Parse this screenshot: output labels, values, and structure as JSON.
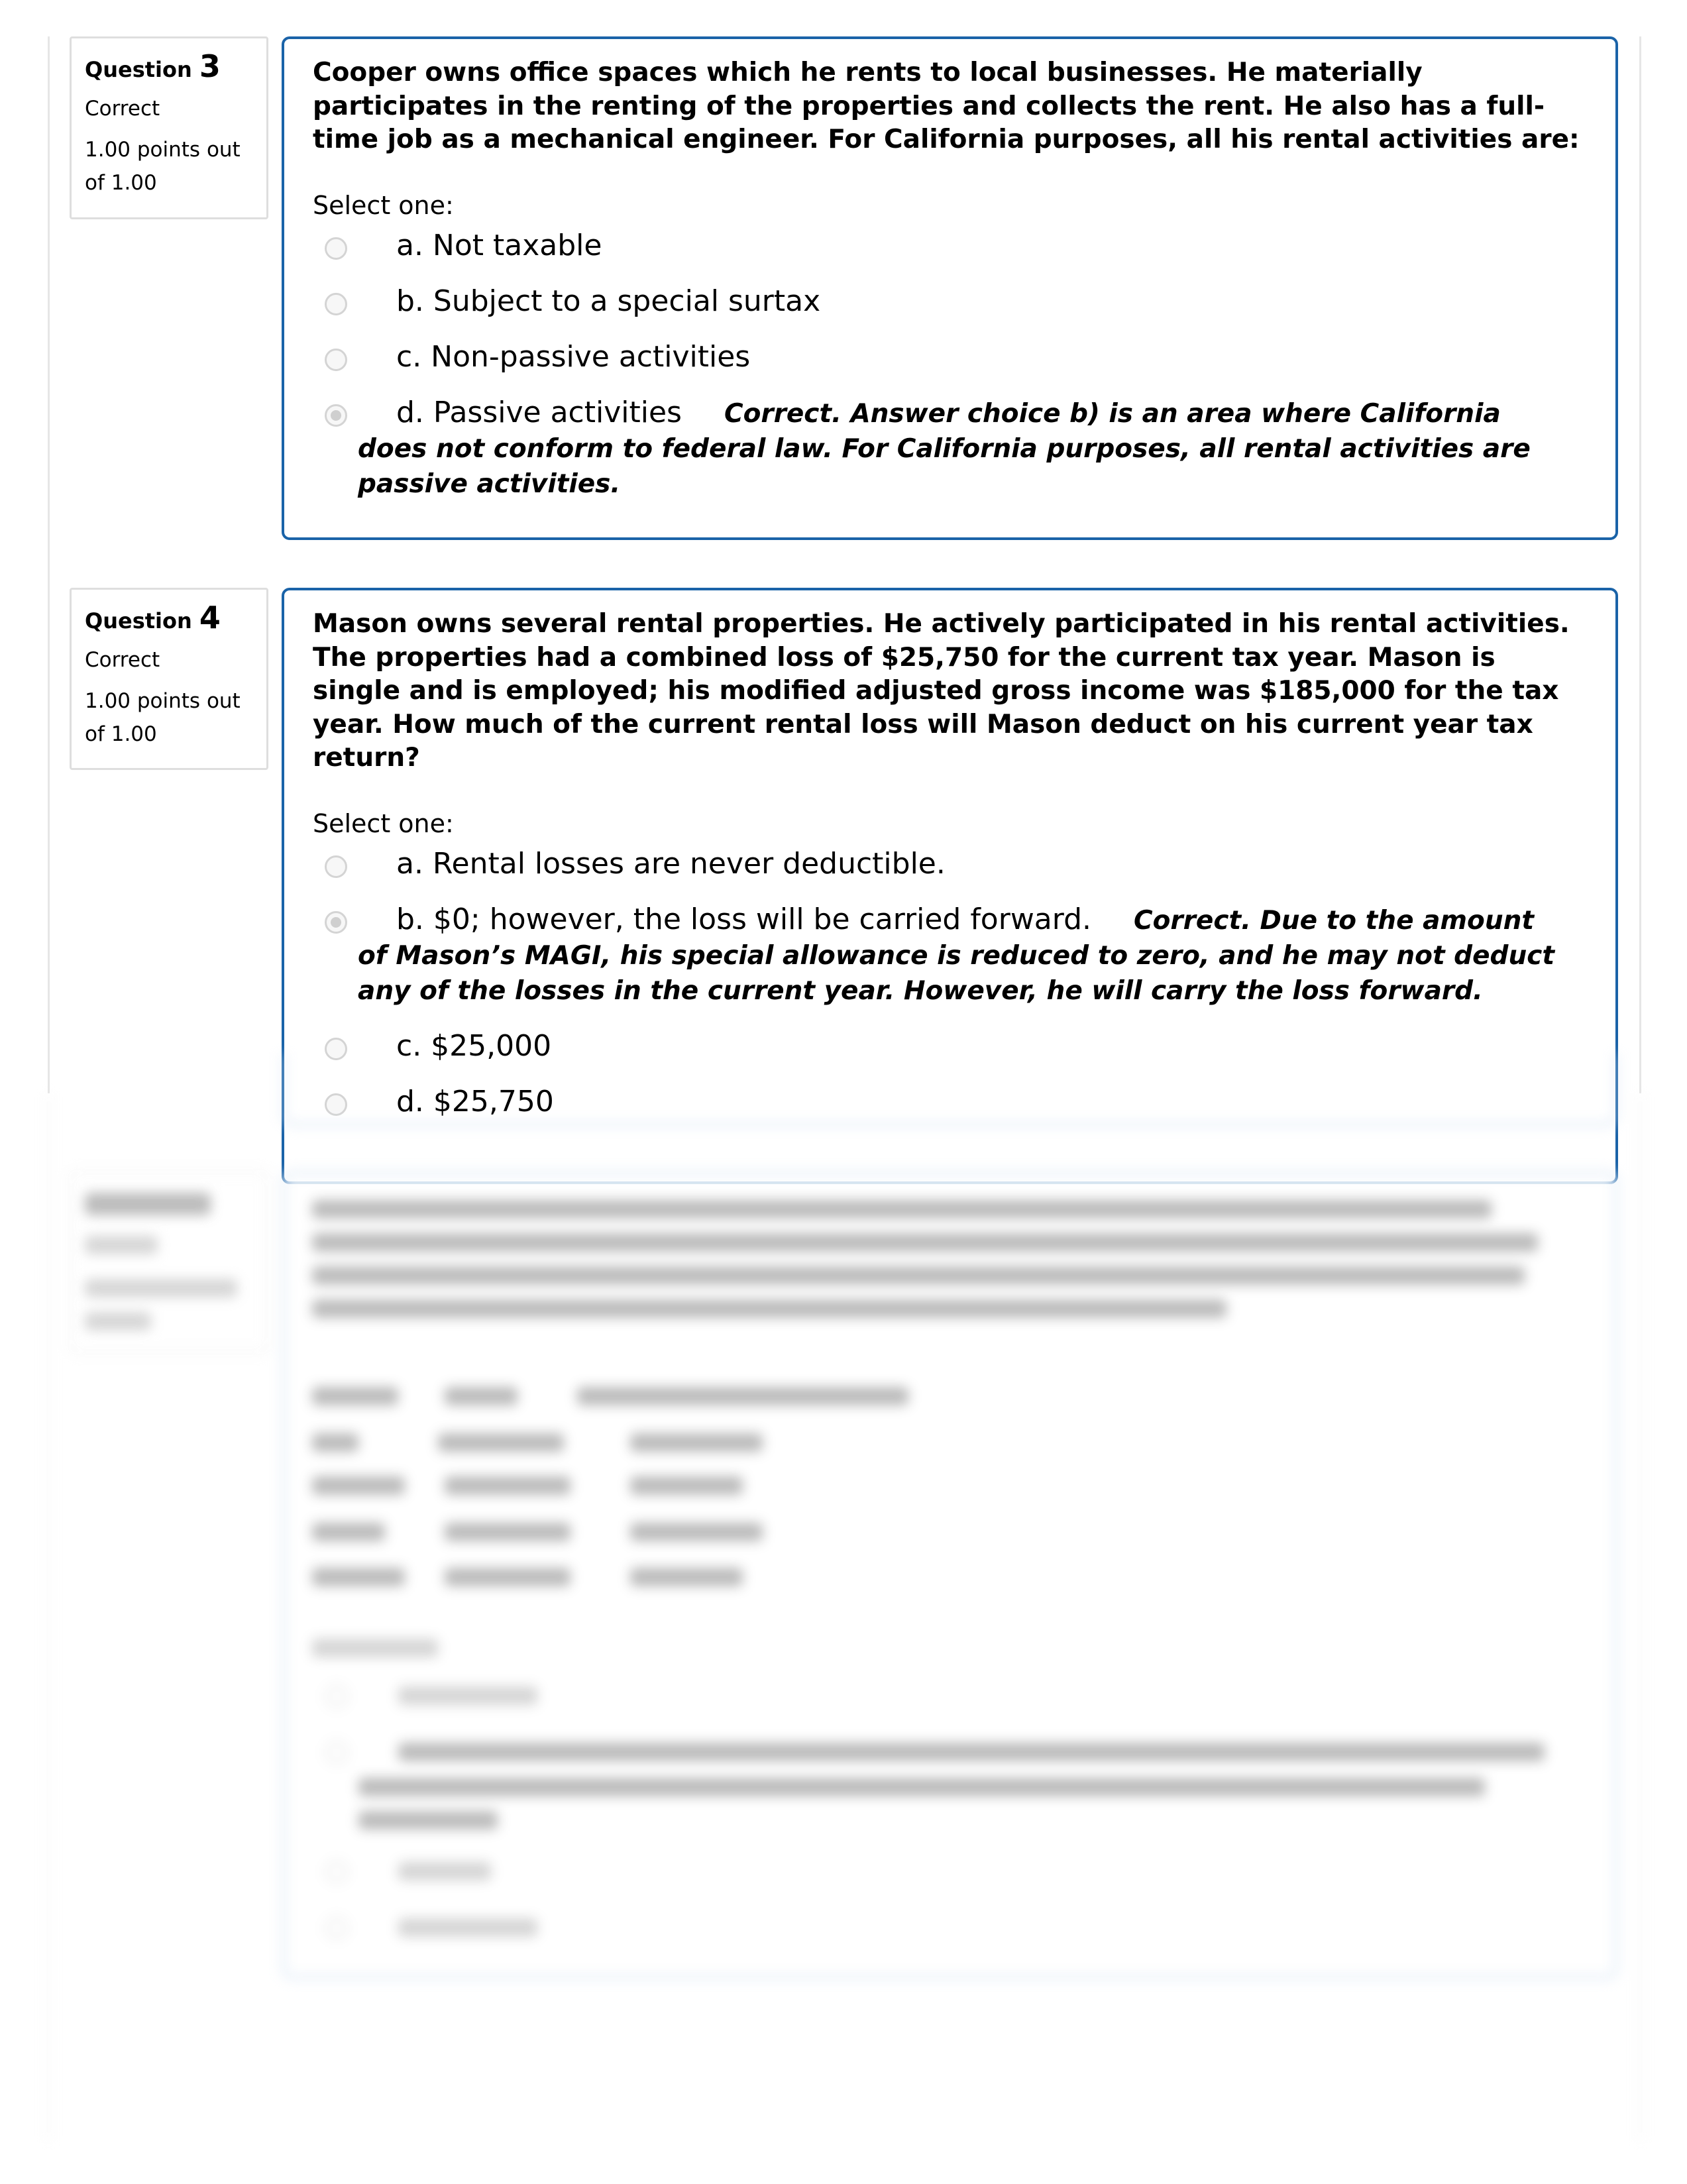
{
  "questions": [
    {
      "label": "Question",
      "number": "3",
      "state": "Correct",
      "grade_line1": "1.00 points out",
      "grade_line2": "of 1.00",
      "text": "Cooper owns office spaces which he rents to local businesses.  He materially participates in the renting of the properties and collects the rent.  He also has a full-time job as a mechanical engineer.  For California purposes, all his rental activities are:",
      "prompt": "Select one:",
      "options": [
        {
          "label": "a. Not taxable",
          "checked": false,
          "feedback": ""
        },
        {
          "label": "b. Subject to a special surtax",
          "checked": false,
          "feedback": ""
        },
        {
          "label": "c. Non-passive activities",
          "checked": false,
          "feedback": ""
        },
        {
          "label": "d. Passive activities",
          "checked": true,
          "feedback": "Correct.  Answer choice b) is an area where California does not conform to federal law.  For California purposes, all rental activities are passive activities."
        }
      ]
    },
    {
      "label": "Question",
      "number": "4",
      "state": "Correct",
      "grade_line1": "1.00 points out",
      "grade_line2": "of 1.00",
      "text": "Mason owns several rental properties.  He actively participated in his rental activities.  The properties had a combined loss of $25,750 for the current tax year.  Mason is single and is employed; his modified adjusted gross income was $185,000 for the tax year.  How much of the current rental loss will Mason deduct on his current year tax return?",
      "prompt": "Select one:",
      "options": [
        {
          "label": "a. Rental losses are never deductible.",
          "checked": false,
          "feedback": ""
        },
        {
          "label": "b. $0; however, the loss will be carried forward.",
          "checked": true,
          "feedback": "Correct.  Due to the amount of Mason’s MAGI, his special allowance is reduced to zero, and he may not deduct any of the losses in the current year.  However, he will carry the loss forward."
        },
        {
          "label": "c. $25,000",
          "checked": false,
          "feedback": ""
        },
        {
          "label": "d. $25,750",
          "checked": false,
          "feedback": ""
        }
      ]
    }
  ],
  "blurred_section": {
    "note": "Question 5 content is obscured (blurred) in the screenshot"
  },
  "colors": {
    "card_border": "#1a63a8",
    "info_border": "#dedede",
    "radio_border": "#d4d4d4"
  }
}
